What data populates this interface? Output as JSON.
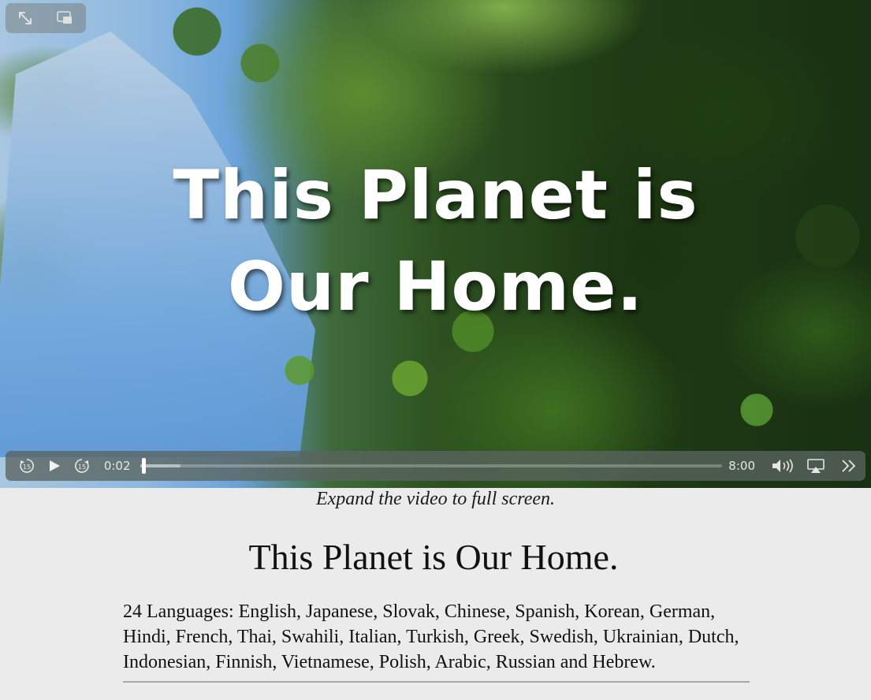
{
  "video": {
    "overlay_line1": "This Planet is",
    "overlay_line2": "Our Home.",
    "current_time": "0:02",
    "duration": "8:00",
    "progress_fraction": 0.004,
    "buffered_fraction": 0.07,
    "icons": {
      "fullscreen": "expand-arrows-icon",
      "pip": "picture-in-picture-icon",
      "skip_back": "skip-back-15-icon",
      "play": "play-icon",
      "skip_forward": "skip-forward-15-icon",
      "volume": "volume-icon",
      "airplay": "airplay-icon",
      "more": "more-chevrons-icon"
    }
  },
  "caption": "Expand the video to full screen.",
  "heading": "This Planet is Our Home.",
  "languages_text": "24 Languages: English, Japanese, Slovak, Chinese, Spanish, Korean, German, Hindi, French, Thai, Swahili, Italian, Turkish, Greek, Swedish, Ukrainian, Dutch, Indonesian, Finnish, Vietnamese, Polish, Arabic, Russian and Hebrew."
}
